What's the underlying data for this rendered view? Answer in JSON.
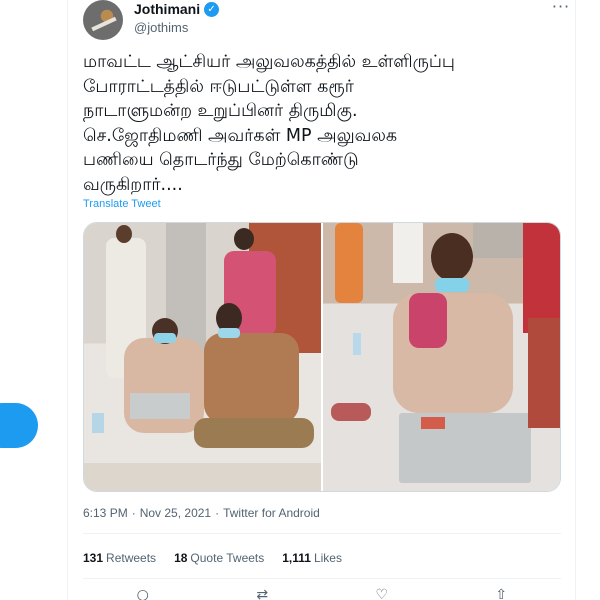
{
  "author": {
    "name": "Jothimani",
    "handle": "@jothims",
    "verified": true
  },
  "tweet": {
    "text_lines": [
      "மாவட்ட ஆட்சியர் அலுவலகத்தில் உள்ளிருப்பு",
      "போராட்டத்தில் ஈடுபட்டுள்ள கரூர்",
      "நாடாளுமன்ற உறுப்பினர் திருமிகு.",
      "செ.ஜோதிமணி  அவர்கள் MP அலுவலக",
      "பணியை தொடர்ந்து மேற்கொண்டு",
      "வருகிறார்...."
    ],
    "translate_label": "Translate Tweet",
    "time": "6:13 PM",
    "separator": "·",
    "date": "Nov 25, 2021",
    "client": "Twitter for Android"
  },
  "stats": {
    "retweets_count": "131",
    "retweets_label": "Retweets",
    "quotes_count": "18",
    "quotes_label": "Quote Tweets",
    "likes_count": "1,111",
    "likes_label": "Likes"
  },
  "icons": {
    "more": "more-icon",
    "reply": "reply-icon",
    "retweet": "retweet-icon",
    "like": "heart-icon",
    "share": "share-icon",
    "verified": "verified-badge-icon"
  },
  "colors": {
    "accent": "#1d9bf0",
    "text": "#0f1419",
    "secondary": "#536471",
    "border": "#eff3f4"
  }
}
